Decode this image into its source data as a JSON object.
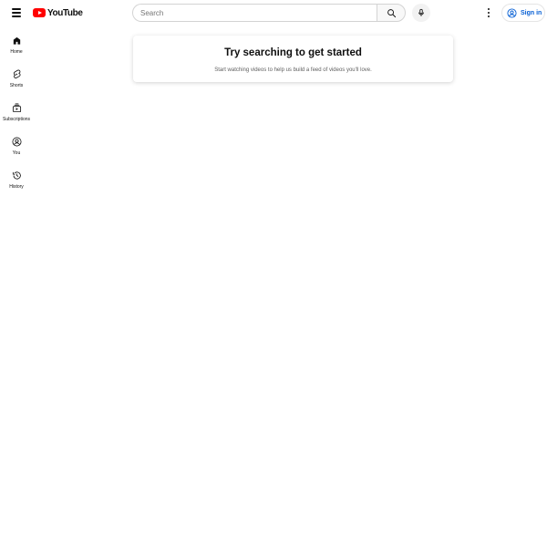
{
  "masthead": {
    "logo_text": "YouTube",
    "search": {
      "placeholder": "Search",
      "value": ""
    },
    "signin_label": "Sign in"
  },
  "guide": {
    "items": [
      {
        "label": "Home",
        "icon": "home-icon"
      },
      {
        "label": "Shorts",
        "icon": "shorts-icon"
      },
      {
        "label": "Subscriptions",
        "icon": "subscriptions-icon"
      },
      {
        "label": "You",
        "icon": "you-icon"
      },
      {
        "label": "History",
        "icon": "history-icon"
      }
    ]
  },
  "prompt": {
    "title": "Try searching to get started",
    "subtitle": "Start watching videos to help us build a feed of videos you'll love."
  },
  "colors": {
    "brand_red": "#ff0000",
    "signin_blue": "#065fd4",
    "text_primary": "#0f0f0f",
    "text_secondary": "#606060"
  }
}
